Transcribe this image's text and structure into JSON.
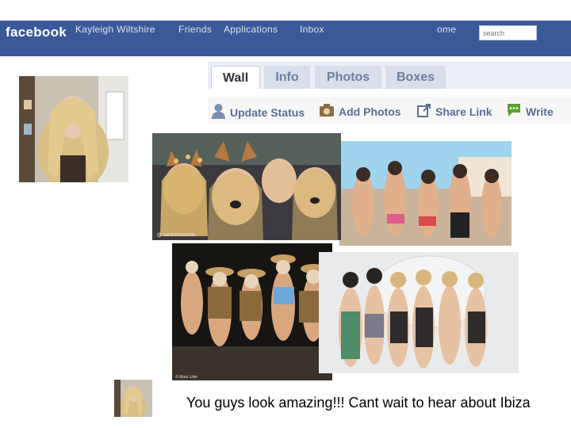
{
  "header": {
    "logo": "facebook",
    "profile_name": "Kayleigh Wiltshire",
    "nav": [
      "Friends",
      "Applications",
      "Inbox"
    ],
    "home": "ome",
    "search_placeholder": "search",
    "bar_color": "#3b5998"
  },
  "tabs": [
    {
      "label": "Wall",
      "active": true
    },
    {
      "label": "Info"
    },
    {
      "label": "Photos"
    },
    {
      "label": "Boxes"
    }
  ],
  "actions": [
    {
      "label": "Update Status",
      "icon": "person-icon"
    },
    {
      "label": "Add Photos",
      "icon": "camera-icon"
    },
    {
      "label": "Share Link",
      "icon": "share-icon"
    },
    {
      "label": "Write",
      "icon": "speech-bubble-icon"
    }
  ],
  "photos": {
    "photo1_credit": "@ sarahmceachie",
    "photo3_credit": "© Mark Liller"
  },
  "comment": {
    "text": "You guys look amazing!!! Cant wait to hear about Ibiza"
  }
}
